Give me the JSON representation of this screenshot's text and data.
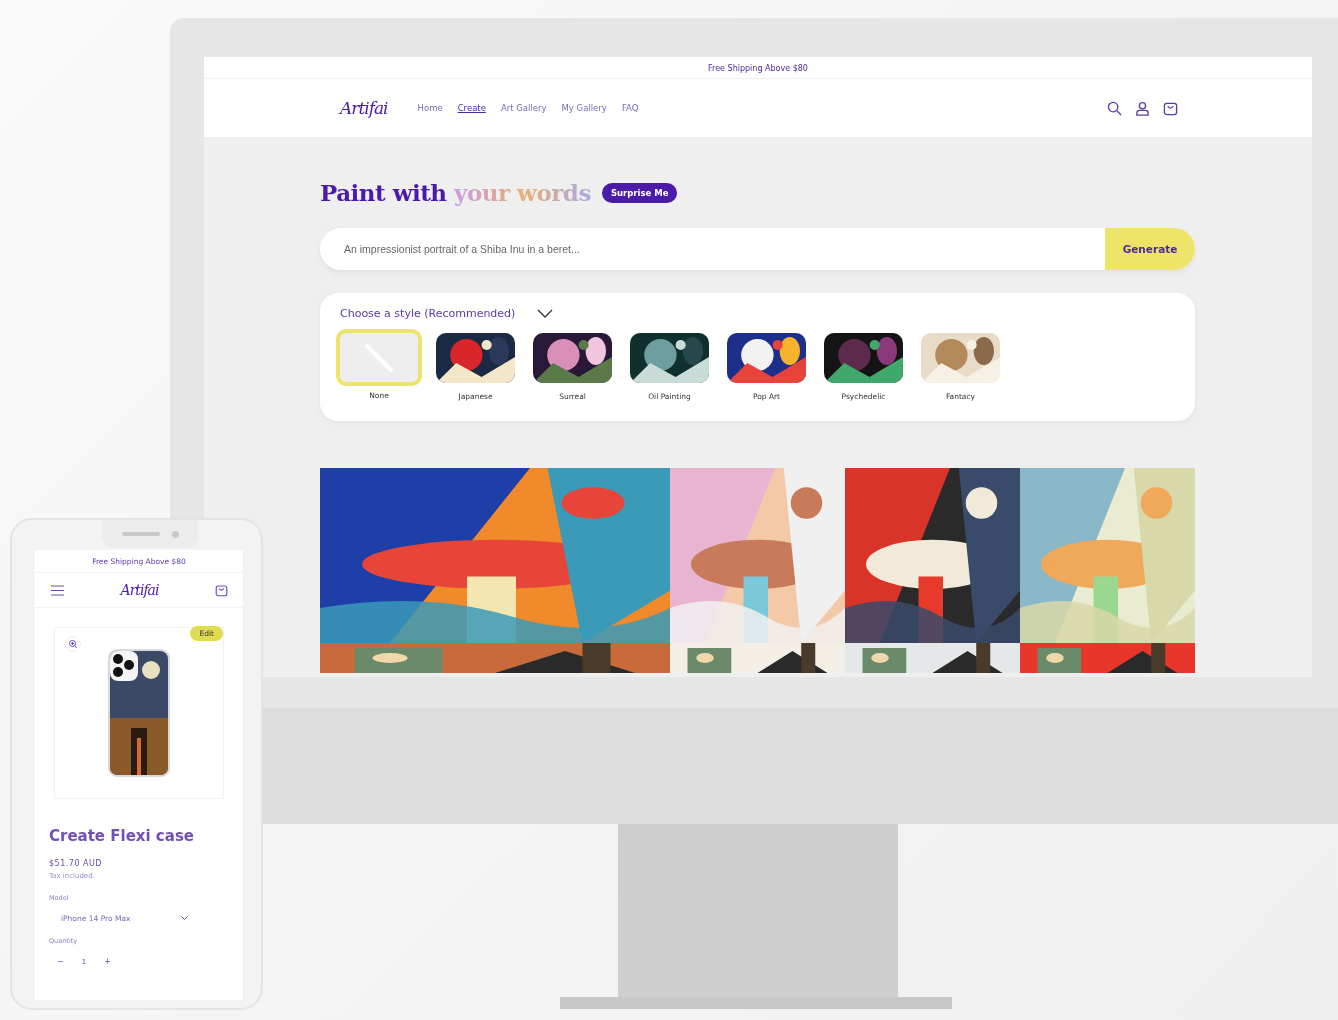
{
  "desktop": {
    "announcement": "Free Shipping Above $80",
    "logo": "Artifai",
    "nav": [
      {
        "label": "Home",
        "selected": false
      },
      {
        "label": "Create",
        "selected": true
      },
      {
        "label": "Art Gallery",
        "selected": false
      },
      {
        "label": "My Gallery",
        "selected": false
      },
      {
        "label": "FAQ",
        "selected": false
      }
    ],
    "heading_start": "Paint with",
    "heading_highlight": "your words",
    "surprise_button": "Surprise Me",
    "prompt": {
      "placeholder": "An impressionist portrait of a Shiba Inu in a beret..."
    },
    "generate_button": "Generate",
    "style_picker": {
      "label": "Choose a style (Recommended)",
      "expanded": true,
      "styles": [
        {
          "label": "None",
          "kind": "none",
          "selected": true
        },
        {
          "label": "Japanese",
          "kind": "picture",
          "selected": false
        },
        {
          "label": "Surreal",
          "kind": "picture",
          "selected": false
        },
        {
          "label": "Oil Painting",
          "kind": "picture",
          "selected": false
        },
        {
          "label": "Pop Art",
          "kind": "picture",
          "selected": false
        },
        {
          "label": "Psychedelic",
          "kind": "picture",
          "selected": false
        },
        {
          "label": "Fantacy",
          "kind": "picture",
          "selected": false
        }
      ]
    }
  },
  "mobile": {
    "announcement": "Free Shipping Above $80",
    "logo": "Artifai",
    "edit_button": "Edit",
    "product_title": "Create Flexi case",
    "price": "$51.70 AUD",
    "tax_note": "Tax included.",
    "model_label": "Model",
    "model": {
      "value": "iPhone 14 Pro Max"
    },
    "quantity_label": "Quantity",
    "quantity": {
      "minus": "−",
      "value": "1",
      "plus": "+"
    }
  }
}
